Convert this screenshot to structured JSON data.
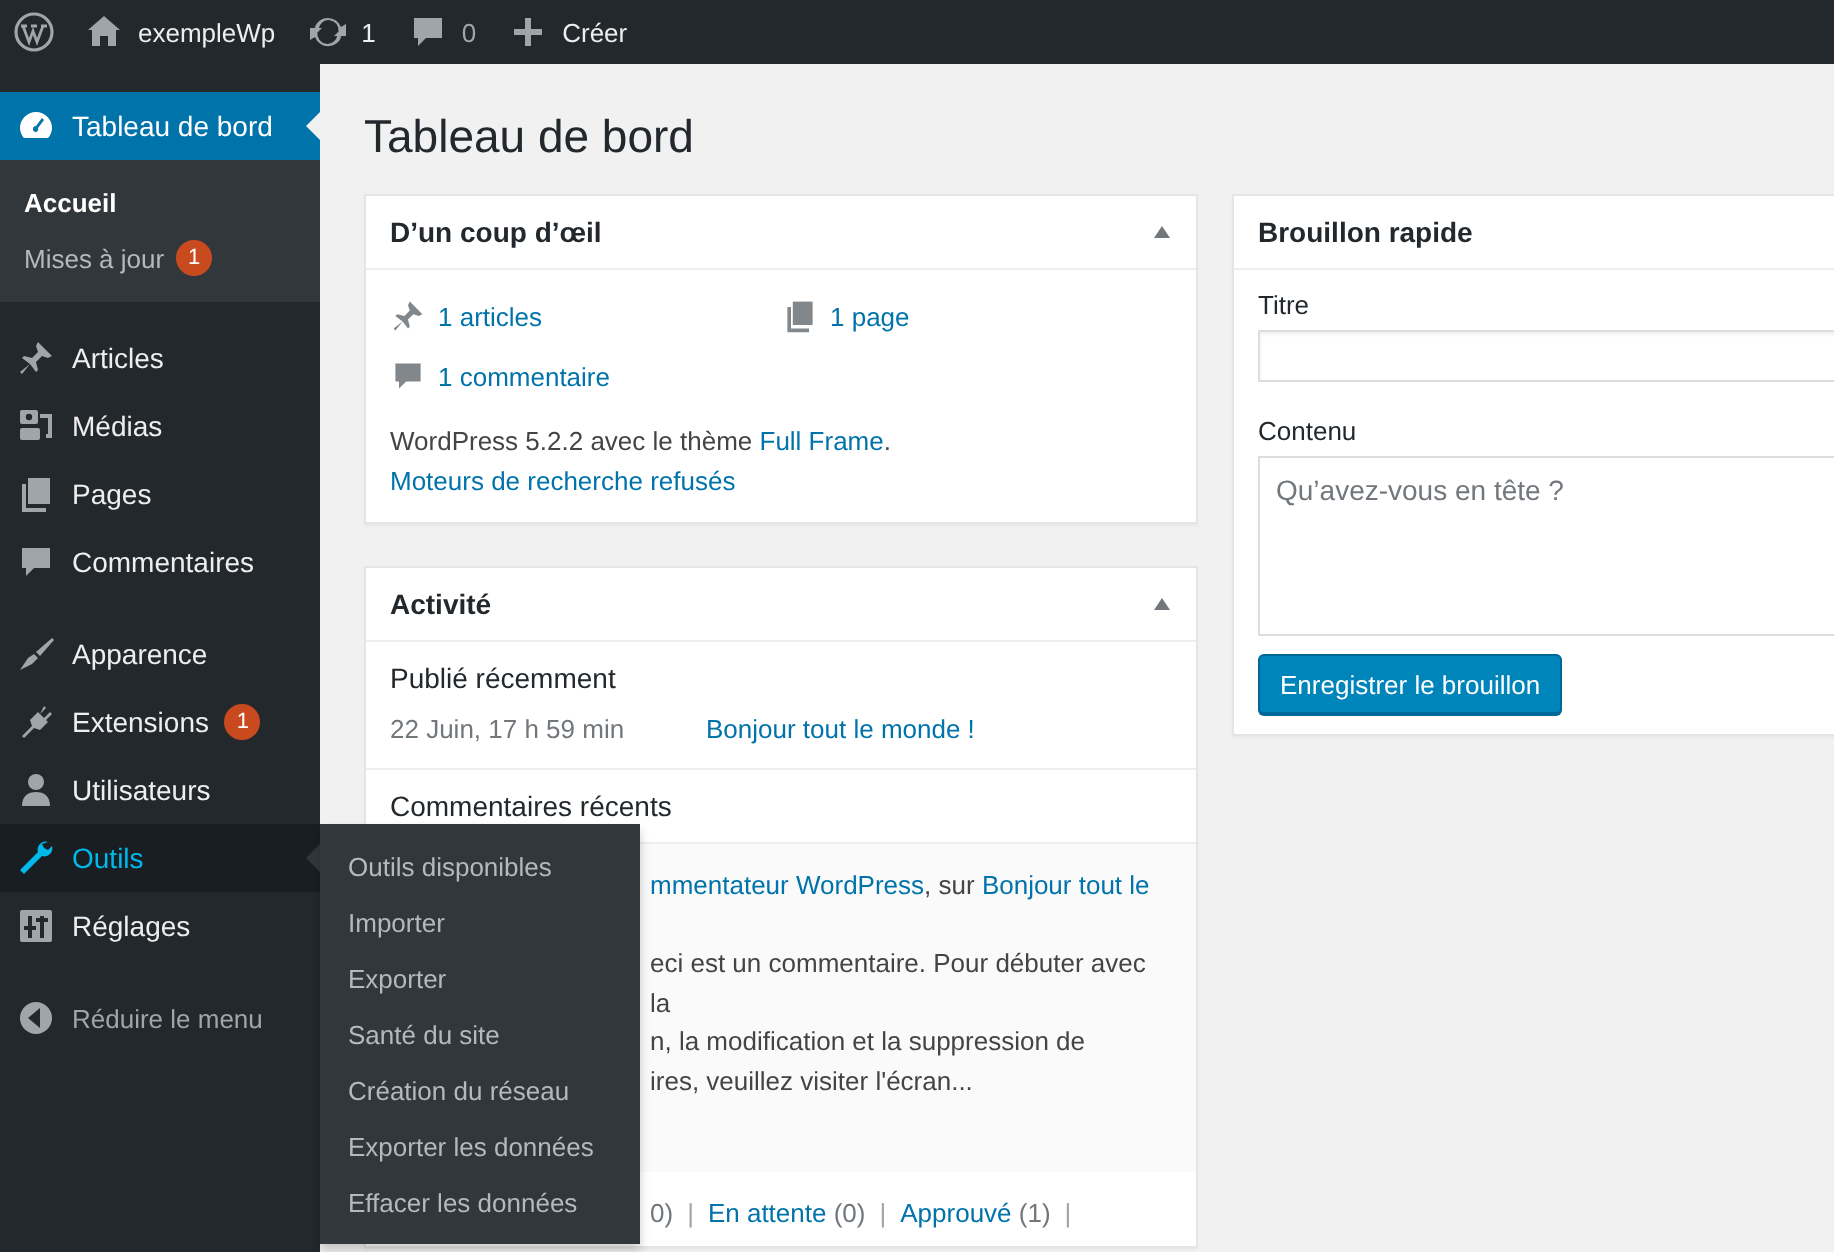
{
  "admin_bar": {
    "site_name": "exempleWp",
    "updates": "1",
    "comments": "0",
    "new_label": "Créer"
  },
  "sidebar": {
    "sections": [
      {
        "items": [
          {
            "label": "Tableau de bord",
            "selected": true,
            "hover": false,
            "children": [
              {
                "label": "Accueil",
                "selected": true
              },
              {
                "label": "Mises à jour",
                "selected": false,
                "badge": "1"
              }
            ]
          }
        ]
      },
      {
        "items": [
          {
            "label": "Articles",
            "selected": false,
            "hover": false
          },
          {
            "label": "Médias",
            "selected": false,
            "hover": false
          },
          {
            "label": "Pages",
            "selected": false,
            "hover": false
          },
          {
            "label": "Commentaires",
            "selected": false,
            "hover": false
          }
        ]
      },
      {
        "items": [
          {
            "label": "Apparence",
            "selected": false,
            "hover": false
          },
          {
            "label": "Extensions",
            "selected": false,
            "hover": false,
            "badge": "1"
          },
          {
            "label": "Utilisateurs",
            "selected": false,
            "hover": false
          },
          {
            "label": "Outils",
            "selected": false,
            "hover": true,
            "flyout": [
              "Outils disponibles",
              "Importer",
              "Exporter",
              "Santé du site",
              "Création du réseau",
              "Exporter les données",
              "Effacer les données"
            ]
          },
          {
            "label": "Réglages",
            "selected": false,
            "hover": false
          }
        ]
      }
    ],
    "collapse_label": "Réduire le menu"
  },
  "page_title": "Tableau de bord",
  "glance": {
    "title": "D’un coup d’œil",
    "counts": [
      "1 articles",
      "1 page",
      "1 commentaire"
    ],
    "version_text": "WordPress 5.2.2 avec le thème ",
    "theme_link": "Full Frame",
    "version_end": ".",
    "search_engines": "Moteurs de recherche refusés"
  },
  "activity": {
    "title": "Activité",
    "published_heading": "Publié récemment",
    "published": [
      {
        "date": "22 Juin, 17 h 59 min",
        "title": "Bonjour tout le monde !"
      }
    ],
    "comments_heading": "Commentaires récents",
    "comment": {
      "author_link": "mmentateur WordPress",
      "sep": ", sur ",
      "post_link": "Bonjour tout le",
      "excerpt": "eci est un commentaire. Pour débuter avec la\nn, la modification et la suppression de\nires, veuillez visiter l'écran..."
    },
    "filters": [
      {
        "count": "0)",
        "separator": "|"
      },
      {
        "label": "En attente",
        "count": "(0)",
        "separator": "|"
      },
      {
        "label": "Approuvé",
        "count": "(1)",
        "separator": "|"
      }
    ]
  },
  "quick_draft": {
    "title": "Brouillon rapide",
    "title_label": "Titre",
    "content_label": "Contenu",
    "content_placeholder": "Qu’avez-vous en tête ?",
    "button": "Enregistrer le brouillon"
  }
}
